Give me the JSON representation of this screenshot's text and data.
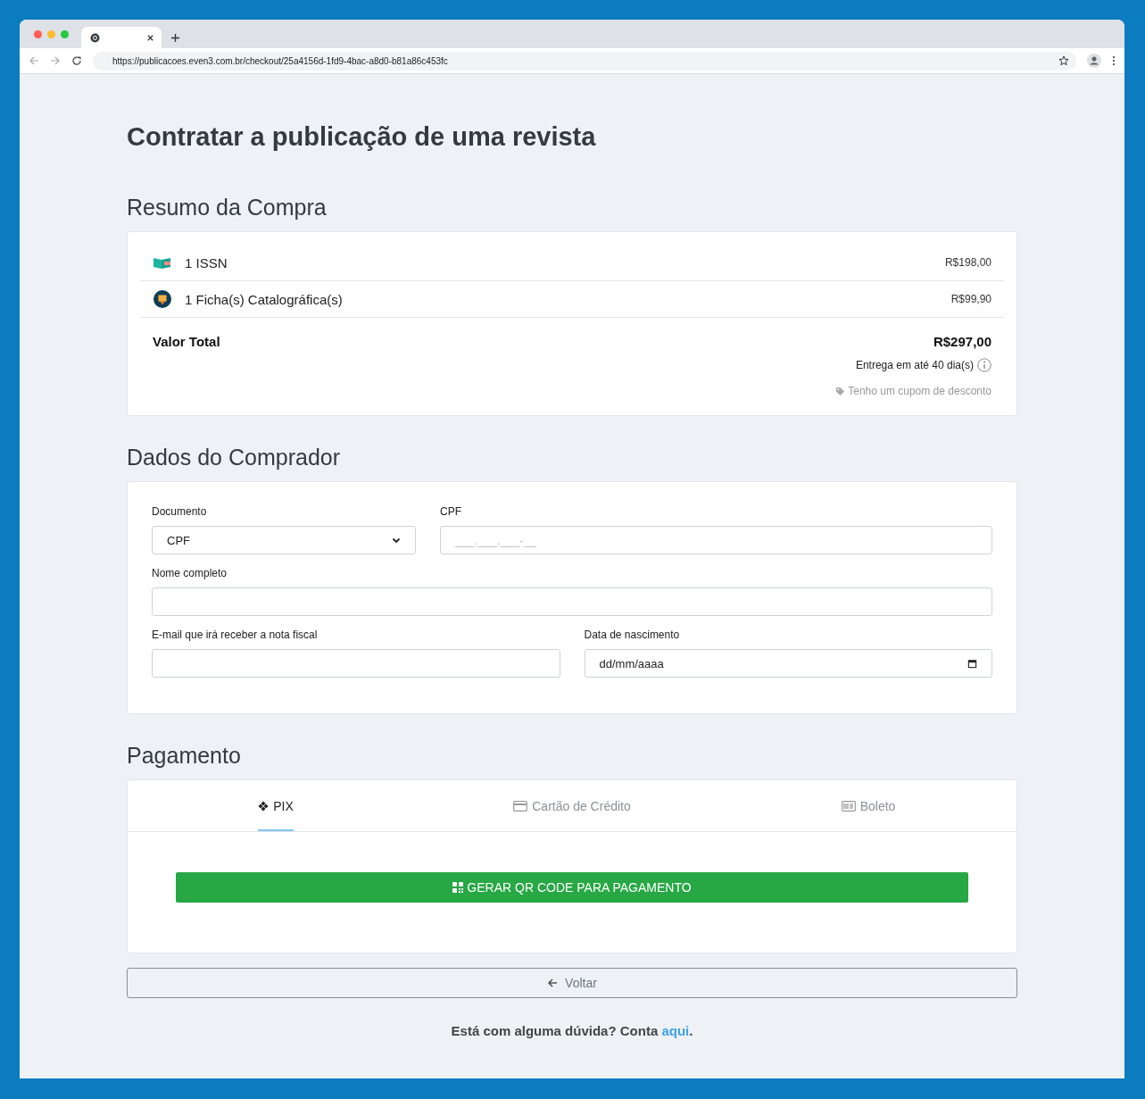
{
  "browser": {
    "url": "https://publicacoes.even3.com.br/checkout/25a4156d-1fd9-4bac-a8d0-b81a86c453fc"
  },
  "page_title": "Contratar a publicação de uma revista",
  "summary": {
    "heading": "Resumo da Compra",
    "items": [
      {
        "kind": "book",
        "label": "1 ISSN",
        "price": "R$198,00"
      },
      {
        "kind": "seal",
        "label": "1 Ficha(s) Catalográfica(s)",
        "price": "R$99,90"
      }
    ],
    "total_label": "Valor Total",
    "total": "R$297,00",
    "delivery": "Entrega em até 40 dia(s)",
    "coupon": "Tenho um cupom de desconto"
  },
  "buyer": {
    "heading": "Dados do Comprador",
    "document": {
      "label": "Documento",
      "value": "CPF"
    },
    "cpf": {
      "label": "CPF",
      "placeholder": "___.___.___-__"
    },
    "name": {
      "label": "Nome completo"
    },
    "email": {
      "label": "E-mail que irá receber a nota fiscal"
    },
    "birth": {
      "label": "Data de nascimento",
      "placeholder": "dd/mm/aaaa"
    }
  },
  "payment": {
    "heading": "Pagamento",
    "tabs": [
      {
        "kind": "pix",
        "label": "PIX",
        "selected": true
      },
      {
        "kind": "card",
        "label": "Cartão de Crédito",
        "selected": false
      },
      {
        "kind": "boleto",
        "label": "Boleto",
        "selected": false
      }
    ],
    "button": "GERAR QR CODE PARA PAGAMENTO"
  },
  "back_button": "Voltar",
  "footer": {
    "text": "Está com alguma dúvida? Conta ",
    "link": "aqui",
    "after": "."
  }
}
